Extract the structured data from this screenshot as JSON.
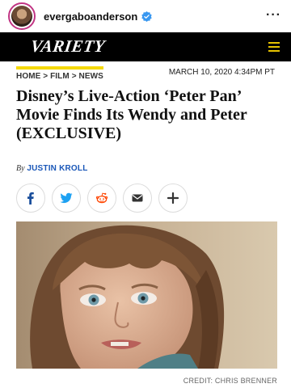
{
  "instagram": {
    "username": "evergaboanderson",
    "verified": true,
    "more_glyph": "···"
  },
  "site": {
    "logo_text": "VARIETY",
    "menu_icon": "hamburger-icon",
    "accent_color": "#f5d90a"
  },
  "article": {
    "breadcrumb": "HOME > FILM > NEWS",
    "date": "MARCH 10, 2020 4:34PM PT",
    "headline": "Disney’s Live-Action ‘Peter Pan’ Movie Finds Its Wendy and Peter (EXCLUSIVE)",
    "byline_prefix": "By",
    "author": "JUSTIN KROLL",
    "photo_credit": "CREDIT: CHRIS BRENNER"
  },
  "share_buttons": [
    {
      "icon": "facebook-icon",
      "color": "#1b4f9c"
    },
    {
      "icon": "twitter-icon",
      "color": "#1da1f2"
    },
    {
      "icon": "reddit-icon",
      "color": "#ff4500"
    },
    {
      "icon": "email-icon",
      "color": "#333333"
    },
    {
      "icon": "plus-icon",
      "color": "#333333"
    }
  ]
}
